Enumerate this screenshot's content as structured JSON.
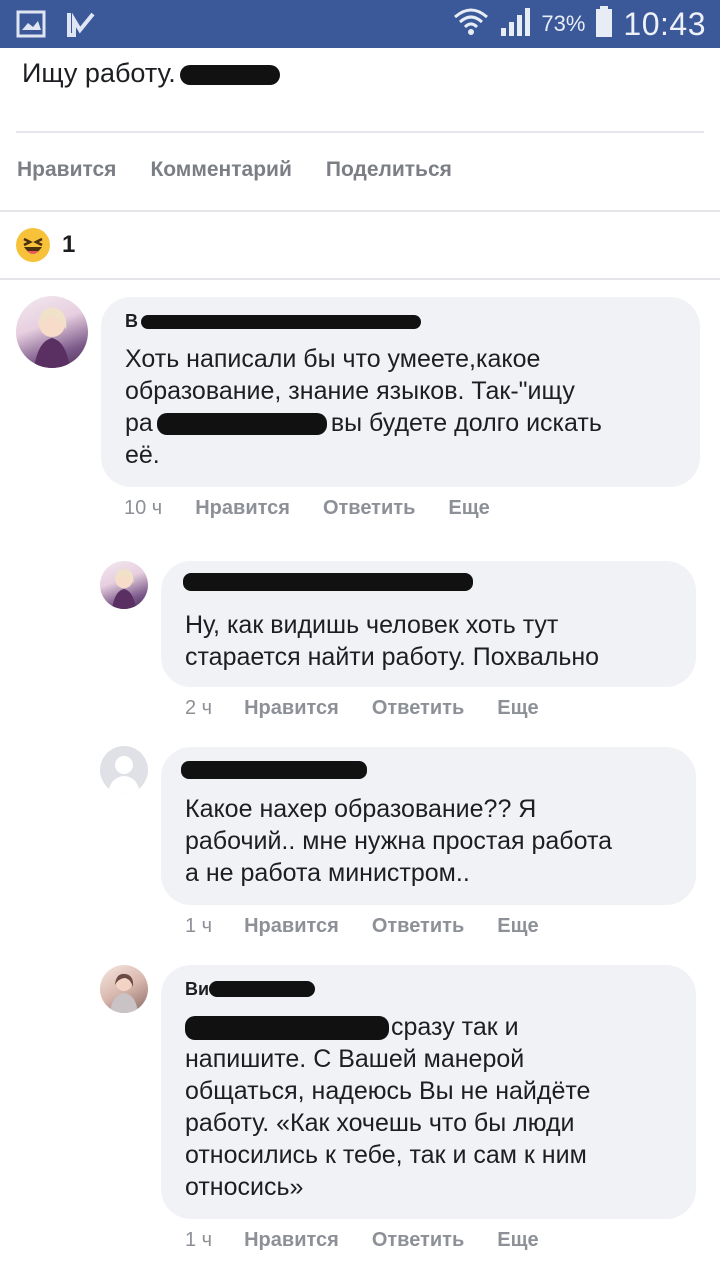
{
  "status_bar": {
    "battery_percent": "73%",
    "time": "10:43",
    "icons": [
      "gallery-icon",
      "check-app-icon",
      "wifi-icon",
      "signal-icon",
      "battery-icon"
    ]
  },
  "post": {
    "text": "Ищу работу.",
    "actions": {
      "like": "Нравится",
      "comment": "Комментарий",
      "share": "Поделиться"
    },
    "reaction_icon": "haha-emoji-icon",
    "reaction_count": "1"
  },
  "comments": [
    {
      "avatar": "user-avatar-photo",
      "name": "В",
      "text": "Хоть написали бы что умеете,какое образование, знание языков. Так-\"ищу ра вы будете долго искать её.",
      "lines": [
        "Хоть написали бы что умеете,какое",
        "образование, знание языков. Так-\"ищу",
        "ра",
        "вы будете долго искать",
        "её."
      ],
      "time": "10 ч",
      "like": "Нравится",
      "reply": "Ответить",
      "more": "Еще"
    },
    {
      "avatar": "user-avatar-photo",
      "name": "",
      "lines": [
        "Ну, как видишь человек хоть тут",
        "старается найти работу. Похвально"
      ],
      "time": "2 ч",
      "like": "Нравится",
      "reply": "Ответить",
      "more": "Еще"
    },
    {
      "avatar": "default-avatar",
      "name": "",
      "lines": [
        "Какое нахер образование?? Я",
        "рабочий.. мне нужна простая работа",
        "а не работа министром.."
      ],
      "time": "1 ч",
      "like": "Нравится",
      "reply": "Ответить",
      "more": "Еще"
    },
    {
      "avatar": "user-avatar-photo",
      "name": "Ви",
      "lines": [
        "сразу так и",
        "напишите. С Вашей манерой",
        "общаться, надеюсь Вы не найдёте",
        "работу. «Как хочешь что бы люди",
        "относились к тебе, так и сам к ним",
        "относись»"
      ],
      "time": "1 ч",
      "like": "Нравится",
      "reply": "Ответить",
      "more": "Еще"
    }
  ],
  "colors": {
    "statusbar": "#3b5998",
    "bubble": "#f0f2f5",
    "meta_text": "#8d9197",
    "action_text": "#7b7f85"
  }
}
